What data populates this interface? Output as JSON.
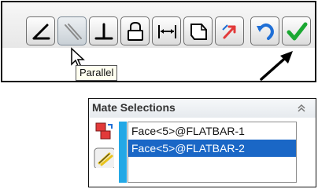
{
  "toolbar": {
    "buttons": [
      {
        "name": "angle-mate-button",
        "icon": "angle-icon",
        "pressed": false
      },
      {
        "name": "parallel-mate-button",
        "icon": "parallel-icon",
        "pressed": true
      },
      {
        "name": "perpendicular-mate-button",
        "icon": "perpendicular-icon",
        "pressed": false
      },
      {
        "name": "lock-mate-button",
        "icon": "lock-icon",
        "pressed": false
      },
      {
        "name": "distance-mate-button",
        "icon": "distance-icon",
        "pressed": false
      },
      {
        "name": "coincident-mate-button",
        "icon": "coincident-icon",
        "pressed": false
      },
      {
        "name": "flip-alignment-button",
        "icon": "flip-alignment-icon",
        "pressed": false
      },
      {
        "name": "undo-button",
        "icon": "undo-icon",
        "pressed": false
      },
      {
        "name": "ok-button",
        "icon": "checkmark-icon",
        "pressed": false
      }
    ],
    "tooltip": "Parallel"
  },
  "mate_selections": {
    "title": "Mate Selections",
    "items": [
      "Face<5>@FLATBAR-1",
      "Face<5>@FLATBAR-2"
    ],
    "selected_index": 1
  },
  "colors": {
    "accent_blue": "#23a8e6",
    "selection_blue": "#1a67c6",
    "ok_green": "#1aa832",
    "undo_blue": "#1f6fd6",
    "flip_red": "#e23a3a"
  }
}
